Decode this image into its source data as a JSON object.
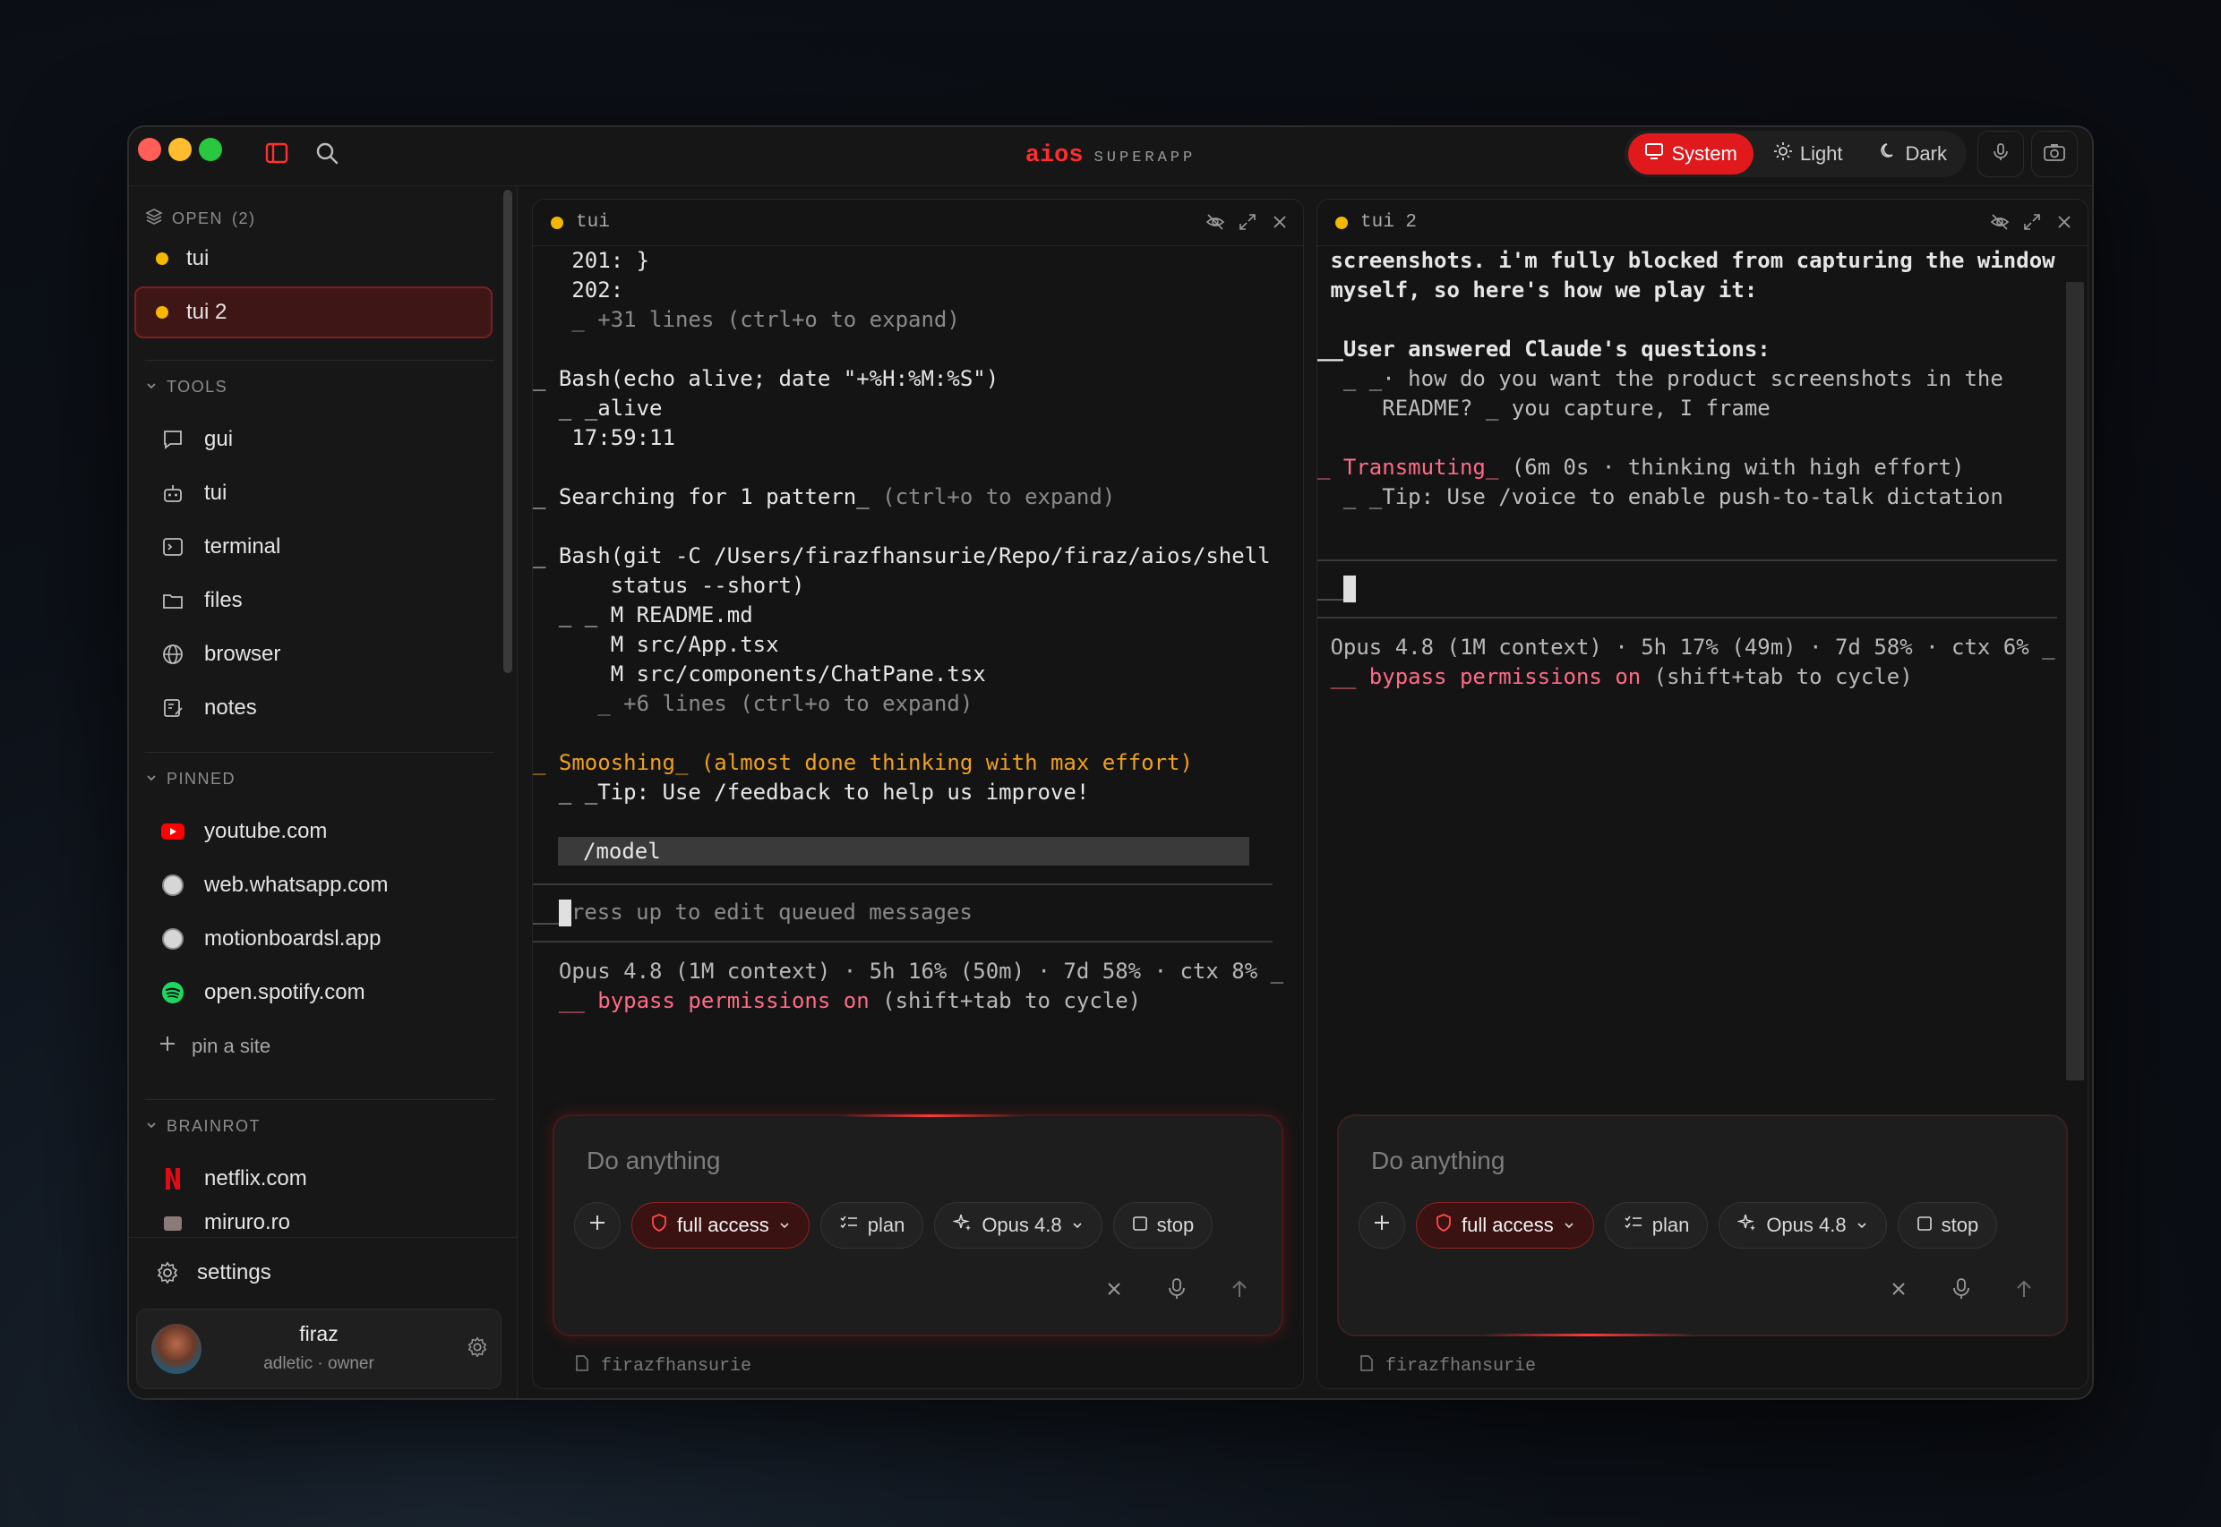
{
  "app": {
    "brand_name": "aios",
    "brand_sub": "SUPERAPP"
  },
  "theme": {
    "system": "System",
    "light": "Light",
    "dark": "Dark",
    "accent": "#e0191d"
  },
  "sidebar": {
    "open_label": "OPEN",
    "open_count": "(2)",
    "open_items": [
      {
        "label": "tui"
      },
      {
        "label": "tui 2"
      }
    ],
    "tools_label": "TOOLS",
    "tools": [
      {
        "label": "gui"
      },
      {
        "label": "tui"
      },
      {
        "label": "terminal"
      },
      {
        "label": "files"
      },
      {
        "label": "browser"
      },
      {
        "label": "notes"
      }
    ],
    "pinned_label": "PINNED",
    "pinned": [
      {
        "label": "youtube.com"
      },
      {
        "label": "web.whatsapp.com"
      },
      {
        "label": "motionboardsl.app"
      },
      {
        "label": "open.spotify.com"
      }
    ],
    "pin_site": "pin a site",
    "brainrot_label": "BRAINROT",
    "brainrot": [
      {
        "label": "netflix.com"
      },
      {
        "label": "miruro.ro"
      }
    ],
    "settings": "settings",
    "user": {
      "name": "firaz",
      "subtitle": "adletic · owner"
    }
  },
  "pane1": {
    "title": "tui",
    "lines": {
      "l1": "   201: }",
      "l2": "   202:",
      "l3": "   _ +31 lines (ctrl+o to expand)",
      "l4": "_ Bash(echo alive; date \"+%H:%M:%S\")",
      "l5": "  _ _alive",
      "l6": "   17:59:11",
      "l7a": "_ Searching for 1 pattern_",
      "l7b": " (ctrl+o to expand)",
      "l8": "_ Bash(git -C /Users/firazfhansurie/Repo/firaz/aios/shell",
      "l9": "      status --short)",
      "l10": "  _ _ M README.md",
      "l11": "      M src/App.tsx",
      "l12": "      M src/components/ChatPane.tsx",
      "l13": "     _ +6 lines (ctrl+o to expand)",
      "l14": "_ Smooshing_ (almost done thinking with max effort)",
      "l15": "  _ _Tip: Use /feedback to help us improve!",
      "l16": "/model",
      "l17a": "__",
      "l17b": "ress up to edit queued messages",
      "l18": "  Opus 4.8 (1M context) · 5h 16% (50m) · 7d 58% · ctx 8% _",
      "l19a": "  __ bypass permissions on",
      "l19b": " (shift+tab to cycle)"
    },
    "composer": {
      "placeholder": "Do anything",
      "access": "full access",
      "plan": "plan",
      "model": "Opus 4.8",
      "stop": "stop"
    },
    "footer": "firazfhansurie"
  },
  "pane2": {
    "title": "tui 2",
    "lines": {
      "l1": " screenshots. i'm fully blocked from capturing the window",
      "l2": " myself, so here's how we play it:",
      "l3": "__User answered Claude's questions:",
      "l4": "  _ _· how do you want the product screenshots in the",
      "l5": "     README? _ you capture, I frame",
      "l6a": "_ Transmuting_",
      "l6b": " (6m 0s · thinking with high effort)",
      "l7": "  _ _Tip: Use /voice to enable push-to-talk dictation",
      "l8": "__",
      "l9": " Opus 4.8 (1M context) · 5h 17% (49m) · 7d 58% · ctx 6% _",
      "l10a": " __ bypass permissions on",
      "l10b": " (shift+tab to cycle)"
    },
    "composer": {
      "placeholder": "Do anything",
      "access": "full access",
      "plan": "plan",
      "model": "Opus 4.8",
      "stop": "stop"
    },
    "footer": "firazfhansurie"
  }
}
